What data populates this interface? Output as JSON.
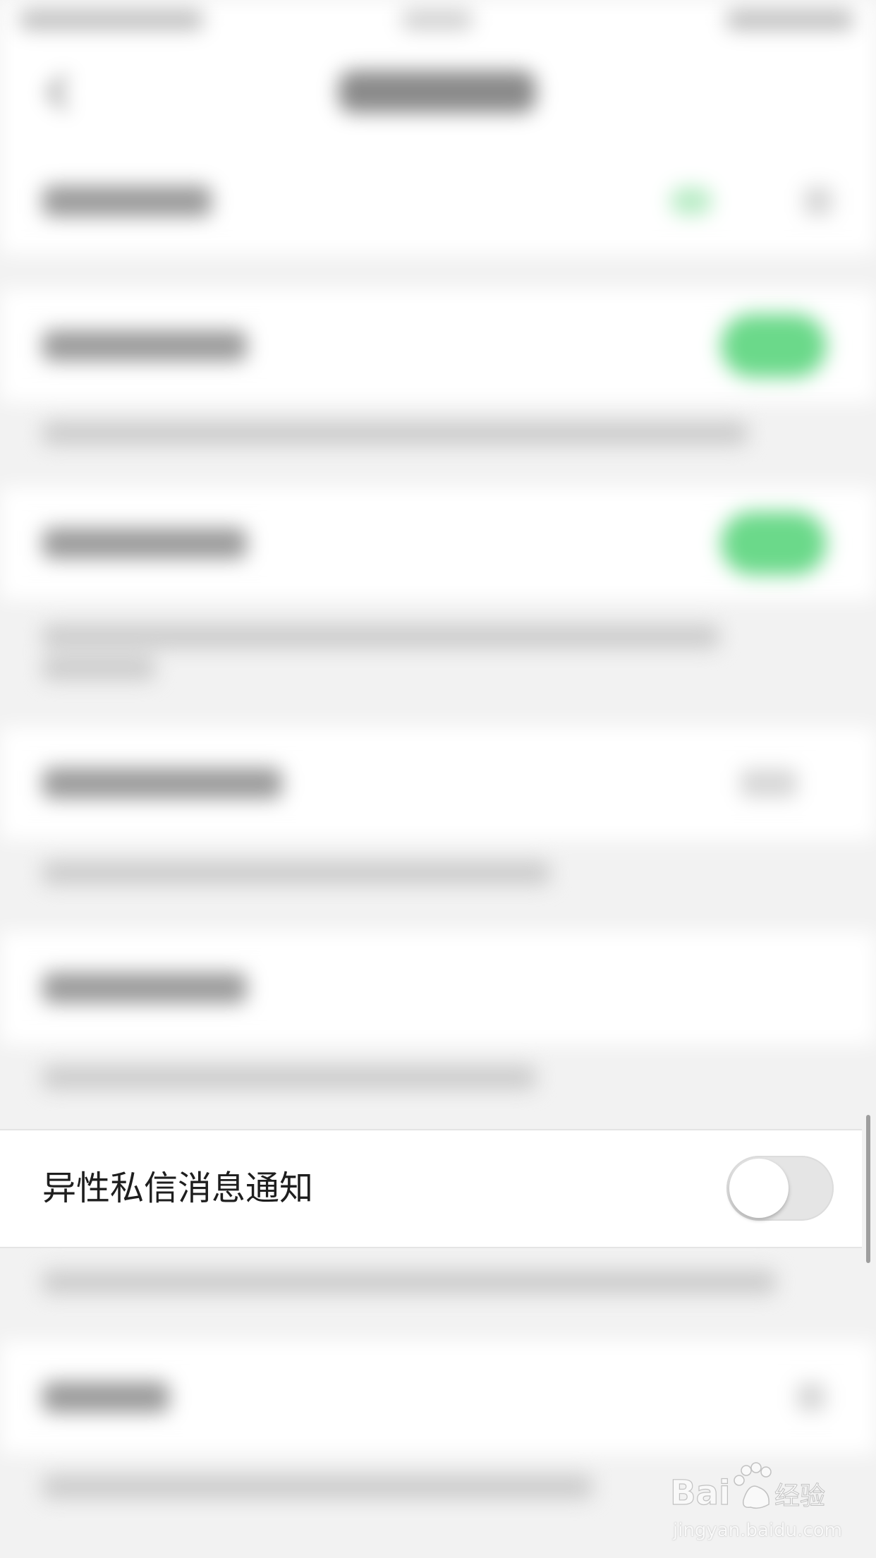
{
  "focused_setting": {
    "label": "异性私信消息通知",
    "toggle_state": "off"
  },
  "colors": {
    "toggle_on_green": "#6bd98a",
    "toggle_off_track": "#e5e5e5",
    "background": "#f2f2f2"
  },
  "watermark": {
    "brand": "Baidu经验",
    "url": "jingyan.baidu.com"
  }
}
